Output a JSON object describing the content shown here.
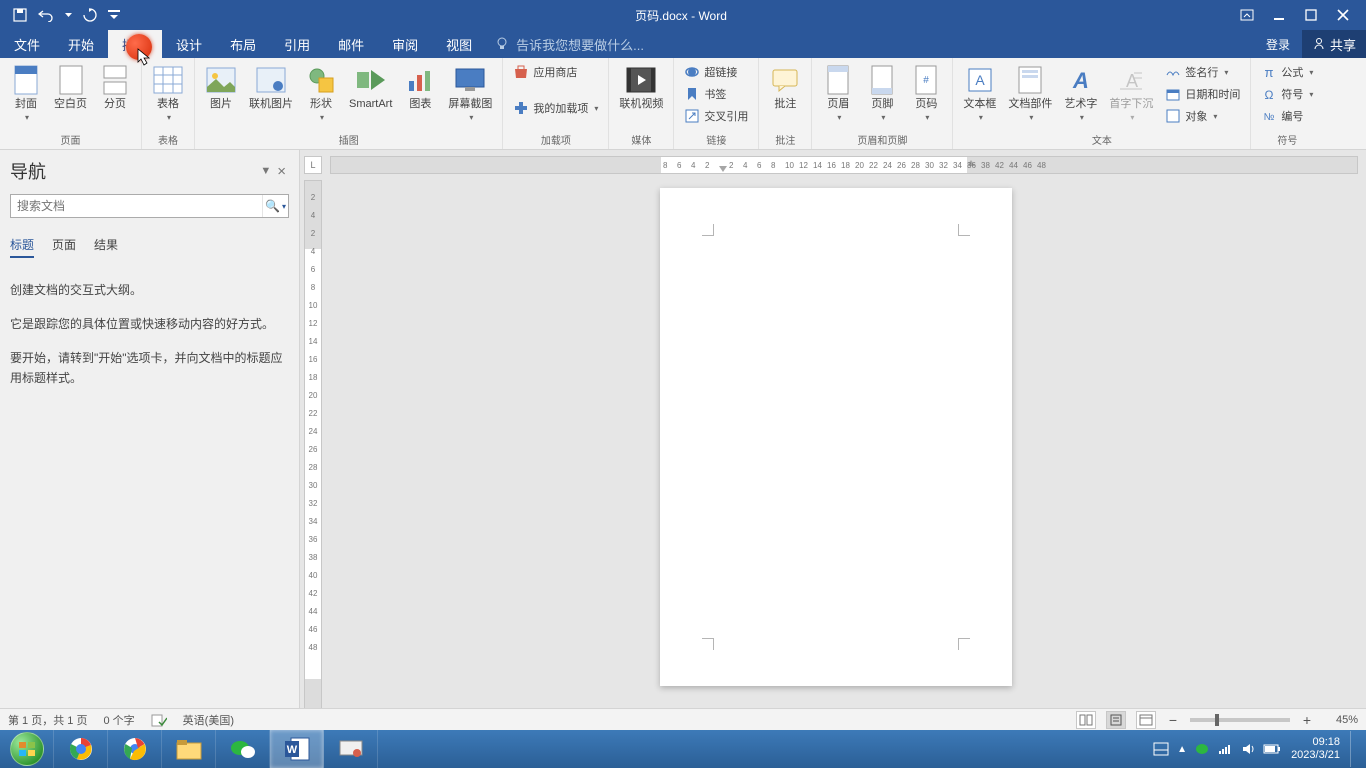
{
  "titlebar": {
    "document_title": "页码.docx - Word"
  },
  "tabs": {
    "file": "文件",
    "home": "开始",
    "insert": "插入",
    "design": "设计",
    "layout": "布局",
    "references": "引用",
    "mailings": "邮件",
    "review": "审阅",
    "view": "视图",
    "tell_me": "告诉我您想要做什么...",
    "login": "登录",
    "share": "共享"
  },
  "ribbon": {
    "groups": {
      "pages": {
        "label": "页面",
        "cover_page": "封面",
        "blank_page": "空白页",
        "page_break": "分页"
      },
      "tables": {
        "label": "表格",
        "table": "表格"
      },
      "illustrations": {
        "label": "插图",
        "picture": "图片",
        "online_pic": "联机图片",
        "shapes": "形状",
        "smartart": "SmartArt",
        "chart": "图表",
        "screenshot": "屏幕截图"
      },
      "addins": {
        "label": "加载项",
        "store": "应用商店",
        "my_addins": "我的加载项"
      },
      "media": {
        "label": "媒体",
        "online_video": "联机视频"
      },
      "links": {
        "label": "链接",
        "hyperlink": "超链接",
        "bookmark": "书签",
        "cross_ref": "交叉引用"
      },
      "comments": {
        "label": "批注",
        "comment": "批注"
      },
      "header_footer": {
        "label": "页眉和页脚",
        "header": "页眉",
        "footer": "页脚",
        "page_number": "页码"
      },
      "text": {
        "label": "文本",
        "text_box": "文本框",
        "quick_parts": "文档部件",
        "word_art": "艺术字",
        "drop_cap": "首字下沉",
        "signature": "签名行",
        "date_time": "日期和时间",
        "object": "对象"
      },
      "symbols": {
        "label": "符号",
        "equation": "公式",
        "symbol": "符号",
        "number": "编号"
      }
    }
  },
  "nav": {
    "title": "导航",
    "search_placeholder": "搜索文档",
    "tabs": {
      "headings": "标题",
      "pages": "页面",
      "results": "结果"
    },
    "body": {
      "p1": "创建文档的交互式大纲。",
      "p2": "它是跟踪您的具体位置或快速移动内容的好方式。",
      "p3": "要开始，请转到\"开始\"选项卡，并向文档中的标题应用标题样式。"
    }
  },
  "ruler": {
    "corner": "L",
    "v_ticks": [
      "2",
      "4",
      "2",
      "4",
      "6",
      "8",
      "10",
      "12",
      "14",
      "16",
      "18",
      "20",
      "22",
      "24",
      "26",
      "28",
      "30",
      "32",
      "34",
      "36",
      "38",
      "40",
      "42",
      "44",
      "46",
      "48"
    ],
    "h_left": [
      "8",
      "6",
      "4",
      "2"
    ],
    "h_right": [
      "2",
      "4",
      "6",
      "8",
      "10",
      "12",
      "14",
      "16",
      "18",
      "20",
      "22",
      "24",
      "26",
      "28",
      "30",
      "32",
      "34",
      "36",
      "38",
      "42",
      "44",
      "46",
      "48"
    ]
  },
  "status": {
    "page_info": "第 1 页，共 1 页",
    "word_count": "0 个字",
    "language": "英语(美国)",
    "zoom": "45%"
  },
  "tray": {
    "time": "09:18",
    "date": "2023/3/21"
  }
}
